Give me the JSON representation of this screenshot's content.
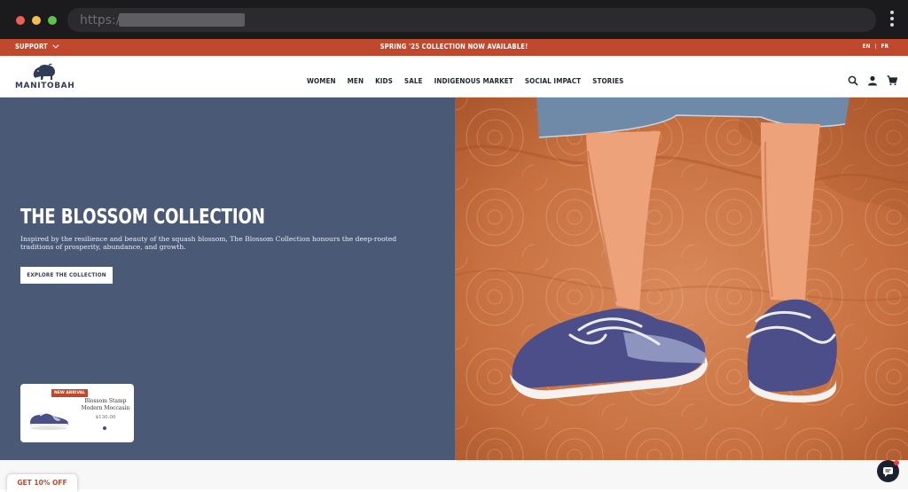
{
  "browser": {
    "url_prefix": "https://"
  },
  "announcement": {
    "support_label": "SUPPORT",
    "promo_text": "SPRING '25 COLLECTION NOW AVAILABLE!",
    "lang_en": "EN",
    "lang_sep": "|",
    "lang_fr": "FR"
  },
  "header": {
    "logo_text": "MANITOBAH",
    "nav": [
      "WOMEN",
      "MEN",
      "KIDS",
      "SALE",
      "INDIGENOUS MARKET",
      "SOCIAL IMPACT",
      "STORIES"
    ],
    "icons": [
      "search-icon",
      "account-icon",
      "cart-icon"
    ]
  },
  "hero": {
    "title": "THE BLOSSOM COLLECTION",
    "description": "Inspired by the resilience and beauty of the squash blossom, The Blossom Collection honours the deep-rooted traditions of prosperity, abundance, and growth.",
    "cta_label": "EXPLORE THE COLLECTION",
    "background_color": "#4a5a76"
  },
  "product_card": {
    "badge": "NEW ARRIVAL",
    "name": "Blossom Stamp Modern Moccasin",
    "price": "$130.00"
  },
  "footer_widgets": {
    "discount_label": "GET 10% OFF",
    "chat_icon": "chat-icon"
  },
  "colors": {
    "accent": "#c0492d",
    "brand_navy": "#2e3d55"
  }
}
